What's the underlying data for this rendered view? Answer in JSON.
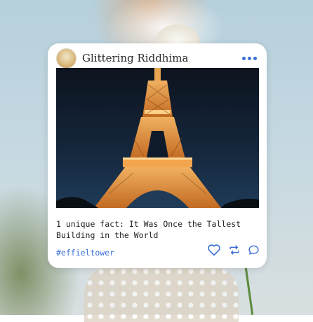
{
  "post": {
    "username": "Glittering Riddhima",
    "caption": "1 unique fact: It Was Once the Tallest Building in the World",
    "hashtag": "#effieltower"
  },
  "icons": {
    "more": "more-horizontal-icon",
    "like": "heart-icon",
    "repost": "repeat-icon",
    "comment": "comment-icon"
  },
  "colors": {
    "accent": "#3b6fd8",
    "card": "#ffffff",
    "photo_sky": "#14253a",
    "tower_lights": "#d98a3a"
  }
}
